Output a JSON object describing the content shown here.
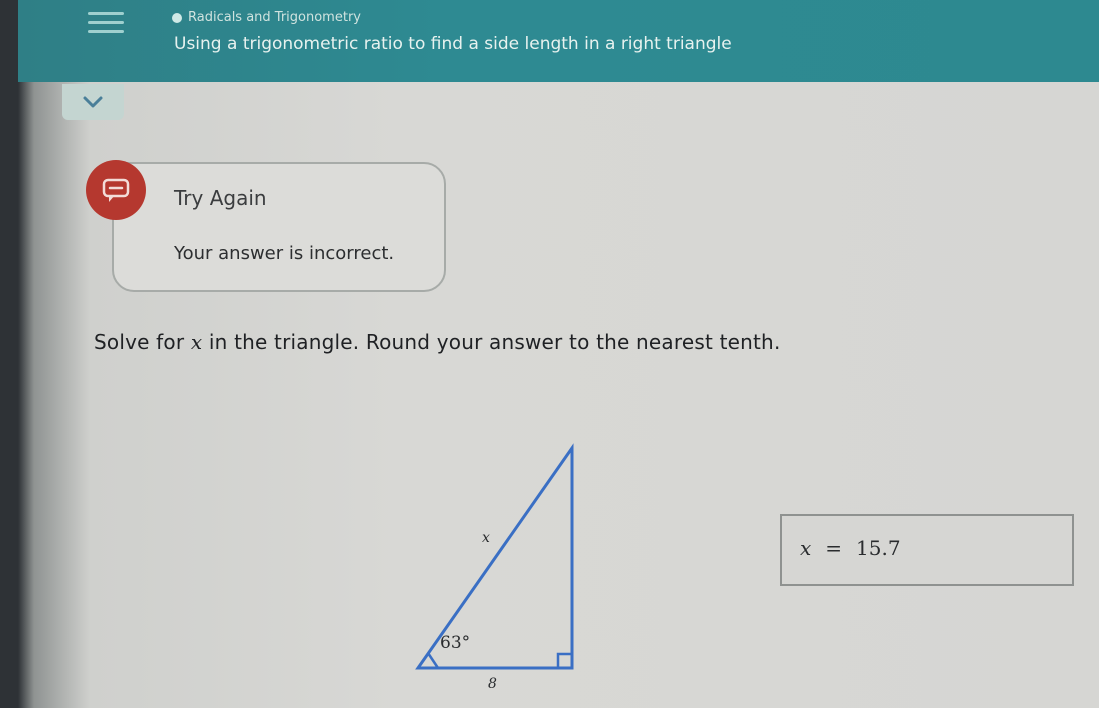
{
  "header": {
    "breadcrumb": "Radicals and Trigonometry",
    "subtitle": "Using a trigonometric ratio to find a side length in a right triangle"
  },
  "feedback": {
    "title": "Try Again",
    "message": "Your answer is incorrect."
  },
  "question": {
    "before": "Solve for ",
    "variable": "x",
    "after": " in the triangle. Round your answer to the nearest tenth."
  },
  "diagram": {
    "hypotenuse_label": "x",
    "angle_label": "63°",
    "base_label": "8"
  },
  "answer": {
    "variable": "x",
    "equals": "=",
    "value": "15.7"
  },
  "colors": {
    "header": "#2e8a92",
    "error": "#b5382f",
    "triangle_stroke": "#3a6fc4"
  }
}
